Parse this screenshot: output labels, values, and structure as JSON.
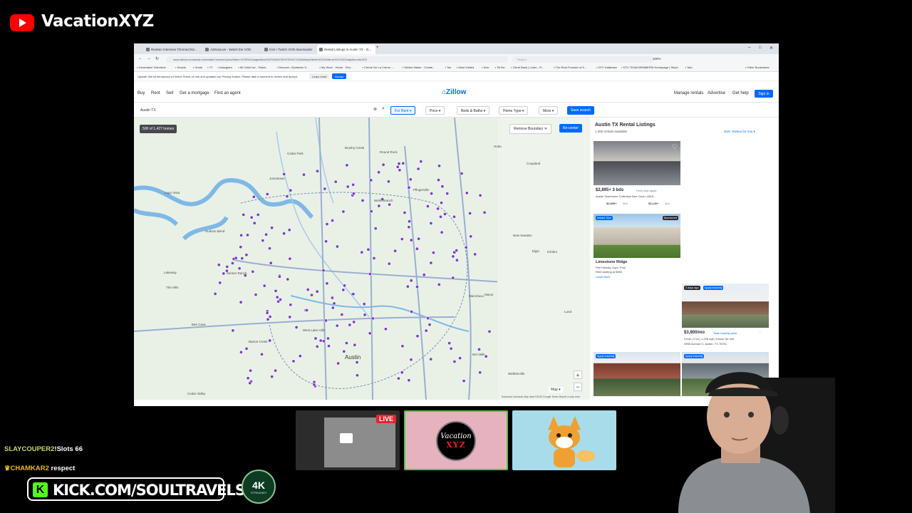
{
  "stream": {
    "channel_name": "VacationXYZ",
    "live_badge": "LIVE",
    "chat": [
      {
        "user": "SLAYCOUPER2",
        "message": "!Slots 66",
        "user_color": "#c9d85a"
      },
      {
        "user": "CHAMKAR2",
        "message": "respect",
        "user_color": "#e7b91b"
      }
    ],
    "kick_url": "KICK.COM/SOULTRAVELS",
    "kick_letter": "K",
    "badge_text": "4K",
    "badge_subtext": "STREAMER",
    "logo_text_top": "Vacation",
    "logo_text_bottom": "XYZ"
  },
  "browser": {
    "tabs": [
      {
        "label": "Reuben Interview Trimmed Ed..."
      },
      {
        "label": "AdmaxLive - Watch the VOD"
      },
      {
        "label": "Kick / Twitch VOD downloader"
      },
      {
        "label": "Rental Listings in Austin TX - Zi..."
      }
    ],
    "new_tab": "+",
    "url": "www.zillow.com/austin-tx/rentals/?searchQueryState=%7B%22pagination%22%3A%7B%7D%2C%22isMapVisible%22%3Atrue%2C%22mapBounds%22",
    "search_placeholder": "Search",
    "zoom": "100%",
    "bookmarks": [
      "Generation Television",
      "Scripts",
      "Gmail",
      "YT",
      "Instagram",
      "Mi ChileLive - Twitch",
      "Discover | Epidemic S...",
      "My Store · Home · Sho...",
      "Crème De La Crème -...",
      "Sticker Maker - Create...",
      "Tax",
      "Most Visited",
      "Kick",
      "TikTok",
      "Climb Bank | Learn - R...",
      "The Real Founder of K...",
      "DTV Database",
      "DTV TEAM MEMBERS",
      "Homepage | Stripe",
      "Tatu",
      "Other Bookmarks"
    ],
    "notice": "Update: We've introduced a Firefox Terms of Use and updated our Privacy Notice. Please take a moment to review and accept.",
    "notice_learn": "Learn more",
    "notice_accept": "Accept"
  },
  "zillow": {
    "nav_left": [
      "Buy",
      "Rent",
      "Sell",
      "Get a mortgage",
      "Find an agent"
    ],
    "logo": "Zillow",
    "nav_right": [
      "Manage rentals",
      "Advertise",
      "Get help"
    ],
    "sign_in": "Sign in",
    "search_value": "Austin TX",
    "filters": [
      {
        "label": "For Rent",
        "active": true
      },
      {
        "label": "Price",
        "active": false
      },
      {
        "label": "Beds & Baths",
        "active": false
      },
      {
        "label": "Home Type",
        "active": false
      },
      {
        "label": "More",
        "active": false
      }
    ],
    "save_search": "Save search",
    "map": {
      "homes_count": "500 of 1,427 homes",
      "remove_boundary": "Remove Boundary",
      "recenter": "Re-center",
      "zoom_in": "+",
      "zoom_out": "−",
      "map_type": "Map",
      "attribution": "Keyboard shortcuts   Map data ©2025 Google   Terms   Report a map error",
      "labels": [
        {
          "text": "Cedar Park"
        },
        {
          "text": "Brushy Creek"
        },
        {
          "text": "Round Rock"
        },
        {
          "text": "Hutto"
        },
        {
          "text": "Lago Vista"
        },
        {
          "text": "Pflugerville"
        },
        {
          "text": "Coupland"
        },
        {
          "text": "Jonestown"
        },
        {
          "text": "Hudson Bend"
        },
        {
          "text": "Wells Branch"
        },
        {
          "text": "Manor"
        },
        {
          "text": "Lakeway"
        },
        {
          "text": "Bee Cave"
        },
        {
          "text": "West Lake Hills"
        },
        {
          "text": "Austin"
        },
        {
          "text": "Del Valle"
        },
        {
          "text": "Elgin"
        },
        {
          "text": "Webberville"
        },
        {
          "text": "Cedar Valley"
        },
        {
          "text": "Steiner Ranch"
        },
        {
          "text": "Kimbro"
        },
        {
          "text": "New Sweden"
        },
        {
          "text": "Lund"
        },
        {
          "text": "Barton Creek"
        },
        {
          "text": "The Hills"
        },
        {
          "text": "Manchaca"
        }
      ]
    },
    "results": {
      "title": "Austin TX Rental Listings",
      "count": "1,392 rentals available",
      "sort": "Sort: Homes for You",
      "cards": [
        {
          "price": "$2,895+ 3 bds",
          "fees": "Fees may apply",
          "name": "Austin Townhome Collection Bee Cave | 4810...",
          "sub_price1": "$2,895+",
          "sub_label1": "3bd",
          "sub_price2": "$3,140+",
          "sub_label2": "4bd"
        },
        {
          "tag_left": "Instant Tour",
          "tag_right": "Sponsored",
          "title": "Limestone Ridge",
          "line1": "Pet Friendly, Gym, Pool",
          "line2": "Rent starting at $999",
          "link": "Learn More"
        },
        {
          "tag_left": "2 days ago",
          "tag_right": "Apply instantly",
          "price": "$3,900/mo",
          "badge": "Total monthly price",
          "line1": "3 bds | 2 ba | 1,208 sqft | House for rent",
          "line2": "4955 Avenue G, Austin, TX 78751"
        },
        {
          "tag_left": "Apply instantly"
        },
        {
          "tag_left": "Apply instantly"
        }
      ]
    }
  },
  "colors": {
    "zillow_blue": "#006aff",
    "listing_pin": "#7b3fc6",
    "kick_green": "#53fc18",
    "youtube_red": "#ff0000",
    "live_red": "#e4262d"
  }
}
